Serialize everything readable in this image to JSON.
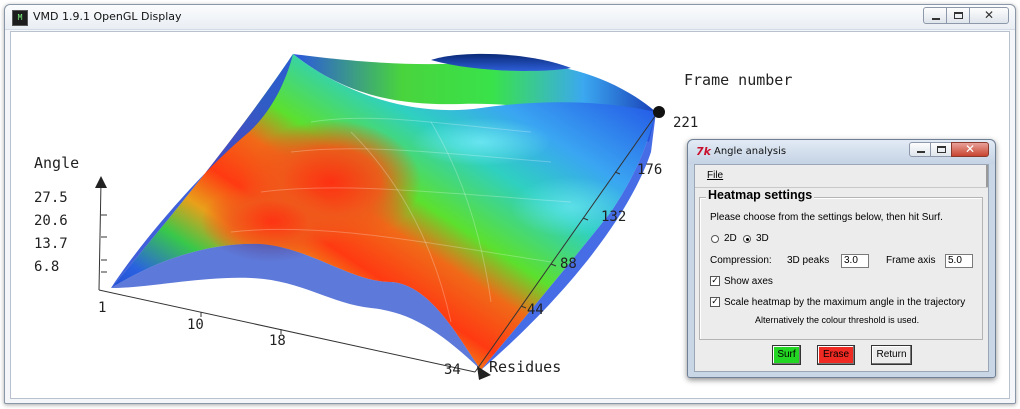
{
  "vmd_window": {
    "title": "VMD 1.9.1 OpenGL Display",
    "icon": "vmd-app-icon",
    "controls": [
      "minimize",
      "maximize",
      "close"
    ]
  },
  "plot": {
    "axis_angle": {
      "title": "Angle",
      "ticks": [
        "27.5",
        "20.6",
        "13.7",
        "6.8"
      ]
    },
    "axis_residues": {
      "title": "Residues",
      "ticks": [
        "1",
        "10",
        "18",
        "34"
      ]
    },
    "axis_frames": {
      "title": "Frame number",
      "ticks": [
        "44",
        "88",
        "132",
        "176",
        "221"
      ]
    },
    "colors": {
      "low": "#1f4fd8",
      "mid_low": "#34c8ff",
      "mid": "#38e03a",
      "high": "#ff2a12",
      "axis": "#333333"
    }
  },
  "dialog": {
    "title": "Angle analysis",
    "icon": "tk-feather-icon",
    "menu": {
      "file": "File"
    },
    "section_title": "Heatmap settings",
    "instruction": "Please choose from the settings below, then hit Surf.",
    "mode": {
      "option_2d": "2D",
      "option_3d": "3D",
      "selected": "3D"
    },
    "compression": {
      "label": "Compression:",
      "peaks_label": "3D peaks",
      "peaks_value": "3.0",
      "frame_label": "Frame axis",
      "frame_value": "5.0"
    },
    "show_axes": {
      "label": "Show axes",
      "checked": true
    },
    "scale_heatmap": {
      "label": "Scale heatmap by the maximum angle in the trajectory",
      "checked": true
    },
    "note": "Alternatively the colour threshold is used.",
    "buttons": {
      "surf": "Surf",
      "erase": "Erase",
      "return": "Return"
    }
  }
}
